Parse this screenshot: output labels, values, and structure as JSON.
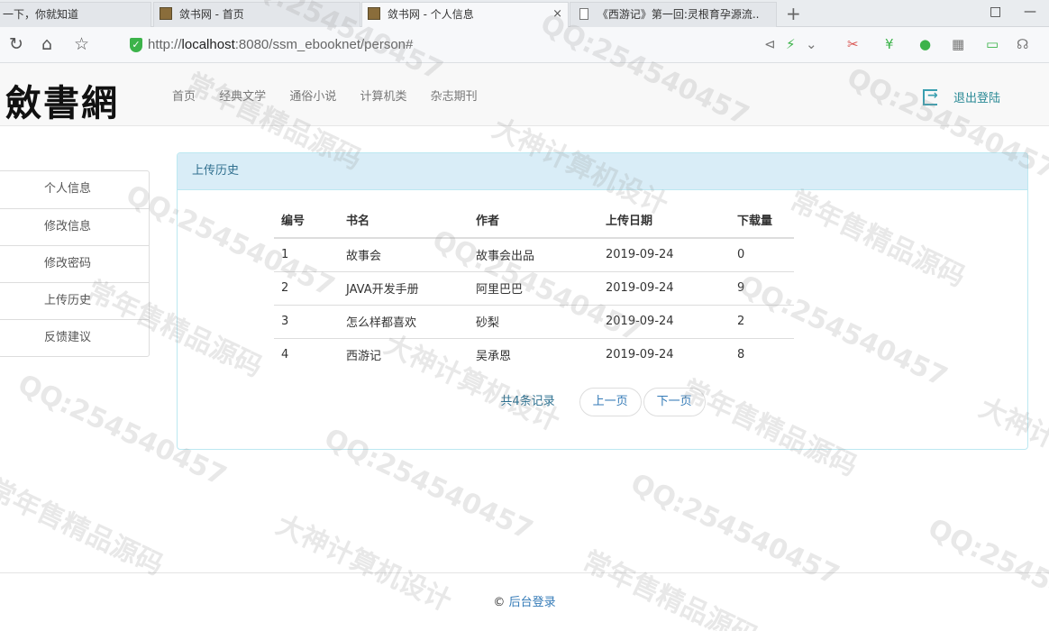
{
  "browser": {
    "tabs": [
      {
        "title": "一下，你就知道",
        "active": false
      },
      {
        "title": "敛书网 - 首页",
        "active": false
      },
      {
        "title": "敛书网 - 个人信息",
        "active": true
      },
      {
        "title": "《西游记》第一回:灵根育孕源流..",
        "active": false
      }
    ],
    "close_glyph": "×",
    "new_tab_glyph": "+",
    "url_prefix": "http://",
    "url_host": "localhost",
    "url_rest": ":8080/ssm_ebooknet/person#"
  },
  "header": {
    "logo": "斂書網",
    "nav": [
      "首页",
      "经典文学",
      "通俗小说",
      "计算机类",
      "杂志期刊"
    ],
    "logout": "退出登陆"
  },
  "sidebar": {
    "items": [
      "个人信息",
      "修改信息",
      "修改密码",
      "上传历史",
      "反馈建议"
    ]
  },
  "panel": {
    "title": "上传历史",
    "columns": [
      "编号",
      "书名",
      "作者",
      "上传日期",
      "下载量"
    ],
    "rows": [
      [
        "1",
        "故事会",
        "故事会出品",
        "2019-09-24",
        "0"
      ],
      [
        "2",
        "JAVA开发手册",
        "阿里巴巴",
        "2019-09-24",
        "9"
      ],
      [
        "3",
        "怎么样都喜欢",
        "砂梨",
        "2019-09-24",
        "2"
      ],
      [
        "4",
        "西游记",
        "吴承恩",
        "2019-09-24",
        "8"
      ]
    ],
    "pager": {
      "count": "共4条记录",
      "prev": "上一页",
      "next": "下一页"
    }
  },
  "footer": {
    "copyright": "©",
    "link": "后台登录"
  },
  "watermarks": [
    "QQ:254540457",
    "常年售精品源码",
    "大神计算机设计"
  ]
}
